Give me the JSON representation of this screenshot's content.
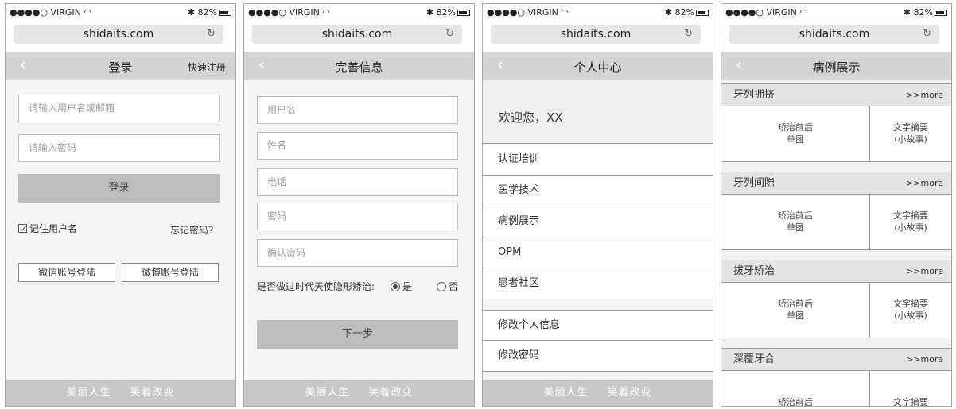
{
  "status": {
    "carrier": "●●●●○ VIRGIN",
    "wifi_icon": "wifi-icon",
    "bluetooth_icon": "bluetooth-icon",
    "battery": "82%"
  },
  "browser": {
    "url": "shidaits.com"
  },
  "footer": {
    "left": "美丽人生",
    "right": "笑着改变"
  },
  "login": {
    "title": "登录",
    "register_link": "快速注册",
    "username_placeholder": "请输入用户名或邮箱",
    "password_placeholder": "请输入密码",
    "login_button": "登录",
    "remember_label": "记住用户名",
    "forgot_link": "忘记密码？",
    "wechat_button": "微信账号登陆",
    "weibo_button": "微博账号登陆"
  },
  "profile_form": {
    "title": "完善信息",
    "fields": [
      "用户名",
      "姓名",
      "电话",
      "密码",
      "确认密码"
    ],
    "question": "是否做过时代天使隐形矫治:",
    "option_yes": "是",
    "option_no": "否",
    "selected": "是",
    "next_button": "下一步"
  },
  "user_center": {
    "title": "个人中心",
    "welcome": "欢迎您，XX",
    "menu": [
      "认证培训",
      "医学技术",
      "病例展示",
      "OPM",
      "患者社区"
    ],
    "settings": [
      "修改个人信息",
      "修改密码"
    ]
  },
  "cases": {
    "title": "病例展示",
    "more_label": ">>more",
    "categories": [
      {
        "name": "牙列拥挤",
        "left_line1": "矫治前后",
        "left_line2": "单图",
        "right_line1": "文字摘要",
        "right_line2": "(小故事)"
      },
      {
        "name": "牙列间隙",
        "left_line1": "矫治前后",
        "left_line2": "单图",
        "right_line1": "文字摘要",
        "right_line2": "(小故事)"
      },
      {
        "name": "拔牙矫治",
        "left_line1": "矫治前后",
        "left_line2": "单图",
        "right_line1": "文字摘要",
        "right_line2": "(小故事)"
      },
      {
        "name": "深覆牙合",
        "left_line1": "矫治前后",
        "left_line2": "",
        "right_line1": "文字摘要",
        "right_line2": ""
      }
    ]
  },
  "colors": {
    "nav_bg": "#d4d4d4",
    "footer_bg": "#c8c8c8",
    "button_bg": "#bdbdbd",
    "content_bg": "#f5f5f5"
  }
}
